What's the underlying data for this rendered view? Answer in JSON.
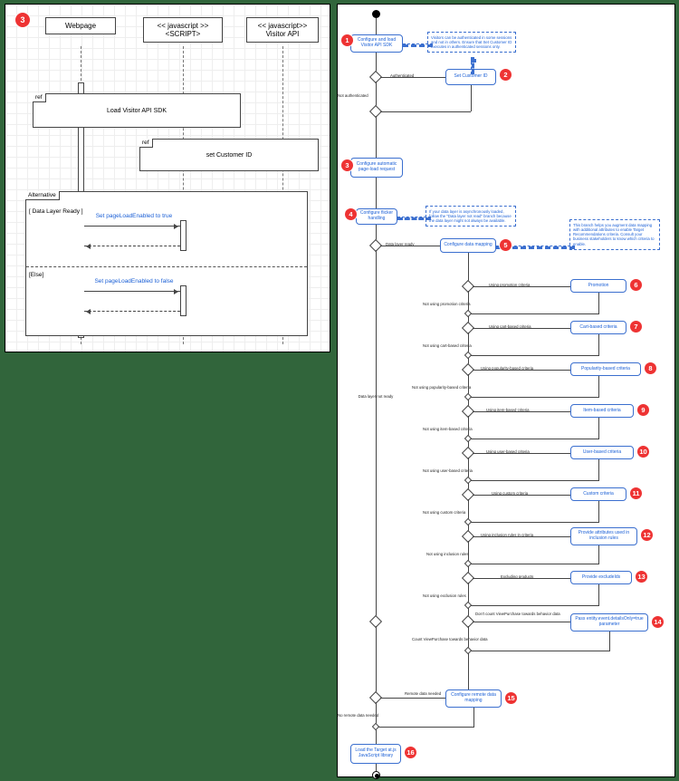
{
  "sequence": {
    "badge": "3",
    "lanes": {
      "webpage": "Webpage",
      "script_stereo": "<< javascript >>",
      "script_name": "<SCRIPT>",
      "api_stereo": "<< javascript>>",
      "api_name": "Visitor API"
    },
    "ref1": {
      "tag": "ref",
      "label": "Load Visitor API SDK"
    },
    "ref2": {
      "tag": "ref",
      "label": "set Customer ID"
    },
    "alt": {
      "tag": "Alternative",
      "guard_true": "[ Data Layer Ready ]",
      "guard_false": "[Else]",
      "msg_true": "Set pageLoadEnabled to true",
      "msg_false": "Set pageLoadEnabled to false"
    }
  },
  "flow": {
    "nodes": {
      "n1": "Configure and load Visitor API SDK",
      "n2": "Set Customer ID",
      "n3": "Configure automatic page-load request",
      "n4": "Configure flicker handling",
      "n5": "Configure data mapping",
      "n6": "Promotion",
      "n7": "Cart-based criteria",
      "n8": "Popularity-based criteria",
      "n9": "Item-based criteria",
      "n10": "User-based criteria",
      "n11": "Custom criteria",
      "n12": "Provide attributes used in inclusion rules",
      "n13": "Provide excludeIds",
      "n14": "Pass entity.event.detailsOnly=true parameter",
      "n15": "Configure remote data mapping",
      "n16": "Load the Target at.js JavaScript library"
    },
    "notes": {
      "note1": "Visitors can be authenticated in some sessions and not in others. Ensure that Set Customer ID executes in authenticated sessions only.",
      "note5a": "If your data layer is asynchronously loaded, follow the \"Data layer not read\" branch because the data layer might not always be available.",
      "note5b": "This branch helps you augment data mapping with additional attributes to enable Target Recommendations criteria. Consult your business stakeholders to know which criteria to enable."
    },
    "edges": {
      "authenticated": "Authenticated",
      "not_authenticated": "Not authenticated",
      "data_layer_ready": "Data layer ready",
      "data_layer_not_ready": "Data layer\nnot ready",
      "using_promotion": "Using promotion criteria",
      "not_using_promotion": "Not using promotion criteria",
      "using_cart": "Using cart-based criteria",
      "not_using_cart": "Not using cart-based criteria",
      "using_popularity": "Using popularity-based criteria",
      "not_using_popularity": "Not using popularity-based criteria",
      "using_item": "Using item-based criteria",
      "not_using_item": "Not using item-based criteria",
      "using_user": "Using user-based criteria",
      "not_using_user": "Not using user-based criteria",
      "using_custom": "Using custom criteria",
      "not_using_custom": "Not using custom criteria",
      "using_inclusion": "Using inclusion rules in criteria",
      "not_using_inclusion": "Not using inclusion rules",
      "excluding": "Excluding products",
      "not_using_exclusion": "Not using exclusion rules",
      "dont_count": "Don't count ViewPurchase towards behavior data",
      "count": "Count ViewPurchase towards behavior data",
      "remote_needed": "Remote data needed",
      "no_remote": "No remote data needed"
    },
    "badges": {
      "b1": "1",
      "b2": "2",
      "b3": "3",
      "b4": "4",
      "b5": "5",
      "b6": "6",
      "b7": "7",
      "b8": "8",
      "b9": "9",
      "b10": "10",
      "b11": "11",
      "b12": "12",
      "b13": "13",
      "b14": "14",
      "b15": "15",
      "b16": "16"
    }
  }
}
